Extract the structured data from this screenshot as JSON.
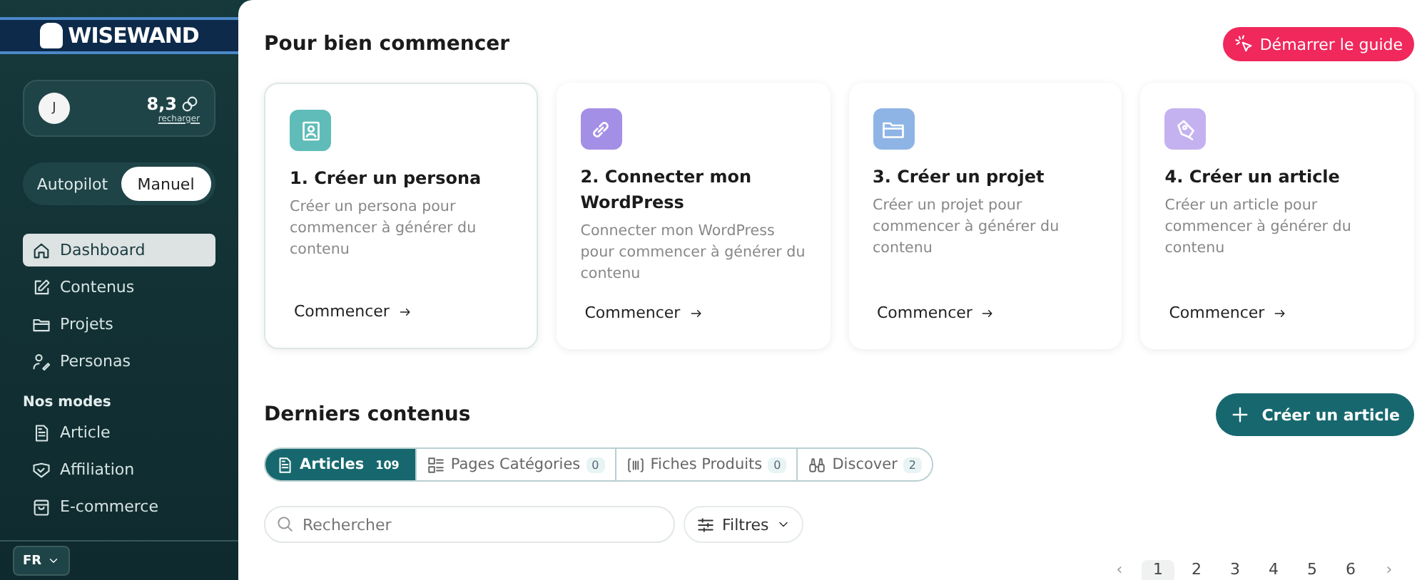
{
  "sidebar": {
    "logo": "WISEWAND",
    "account": {
      "avatar": "J",
      "credits": "8,3",
      "recharge": "recharger"
    },
    "modes": [
      {
        "label": "Autopilot",
        "selected": false
      },
      {
        "label": "Manuel",
        "selected": true
      }
    ],
    "nav": [
      {
        "label": "Dashboard",
        "selected": true
      },
      {
        "label": "Contenus",
        "selected": false
      },
      {
        "label": "Projets",
        "selected": false
      },
      {
        "label": "Personas",
        "selected": false
      }
    ],
    "section_title": "Nos modes",
    "mode_items": [
      {
        "label": "Article",
        "selected": false
      },
      {
        "label": "Affiliation",
        "selected": false
      },
      {
        "label": "E-commerce",
        "selected": false
      }
    ],
    "language": "FR"
  },
  "getting_started": {
    "title": "Pour bien commencer",
    "guide_button": "Démarrer le guide",
    "cards": [
      {
        "color": "#5fbcb8",
        "title": "1. Créer un persona",
        "text": "Créer un persona pour commencer à générer du contenu",
        "action": "Commencer"
      },
      {
        "color": "#a48fe6",
        "title": "2. Connecter mon WordPress",
        "text": "Connecter mon WordPress pour commencer à générer du contenu",
        "action": "Commencer"
      },
      {
        "color": "#8eb4e6",
        "title": "3. Créer un projet",
        "text": "Créer un projet pour commencer à générer du contenu",
        "action": "Commencer"
      },
      {
        "color": "#c4b2f0",
        "title": "4. Créer un article",
        "text": "Créer un article pour commencer à générer du contenu",
        "action": "Commencer"
      }
    ]
  },
  "latest": {
    "title": "Derniers contenus",
    "create_button": "Créer un article",
    "tabs": [
      {
        "label": "Articles",
        "count": "109",
        "selected": true
      },
      {
        "label": "Pages Catégories",
        "count": "0",
        "selected": false
      },
      {
        "label": "Fiches Produits",
        "count": "0",
        "selected": false
      },
      {
        "label": "Discover",
        "count": "2",
        "selected": false
      }
    ],
    "search": {
      "placeholder": "Rechercher"
    },
    "filter": "Filtres",
    "pagination": {
      "prev": "‹",
      "pages": [
        {
          "label": "1",
          "selected": true
        },
        {
          "label": "2",
          "selected": false
        },
        {
          "label": "3",
          "selected": false
        },
        {
          "label": "4",
          "selected": false
        },
        {
          "label": "5",
          "selected": false
        },
        {
          "label": "6",
          "selected": false
        }
      ],
      "next": "›"
    }
  }
}
